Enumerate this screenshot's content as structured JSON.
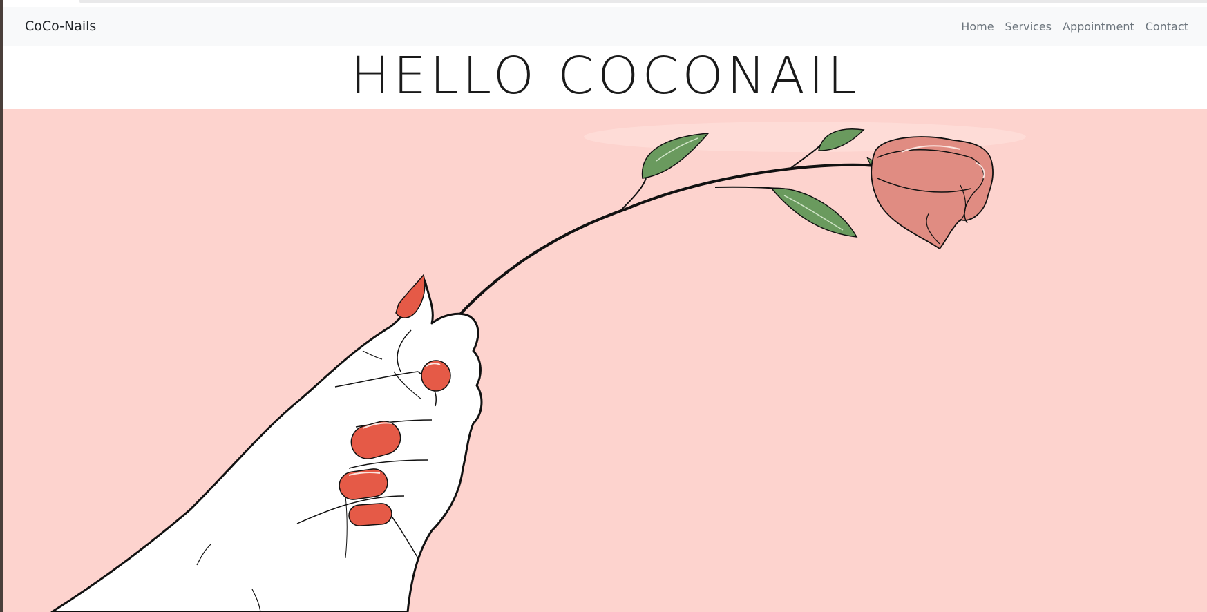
{
  "navbar": {
    "brand": "CoCo-Nails",
    "links": [
      {
        "label": "Home"
      },
      {
        "label": "Services"
      },
      {
        "label": "Appointment"
      },
      {
        "label": "Contact"
      }
    ]
  },
  "hero": {
    "title": "HELLO COCONAIL",
    "image_subject": "hand-holding-rose-illustration"
  },
  "colors": {
    "navbar_bg": "#f8f9fa",
    "hero_bg": "#fdd3ce",
    "nail": "#e55a47",
    "rose": "#e08c82",
    "leaf": "#6a9a5e",
    "nav_link": "#6c757d"
  }
}
